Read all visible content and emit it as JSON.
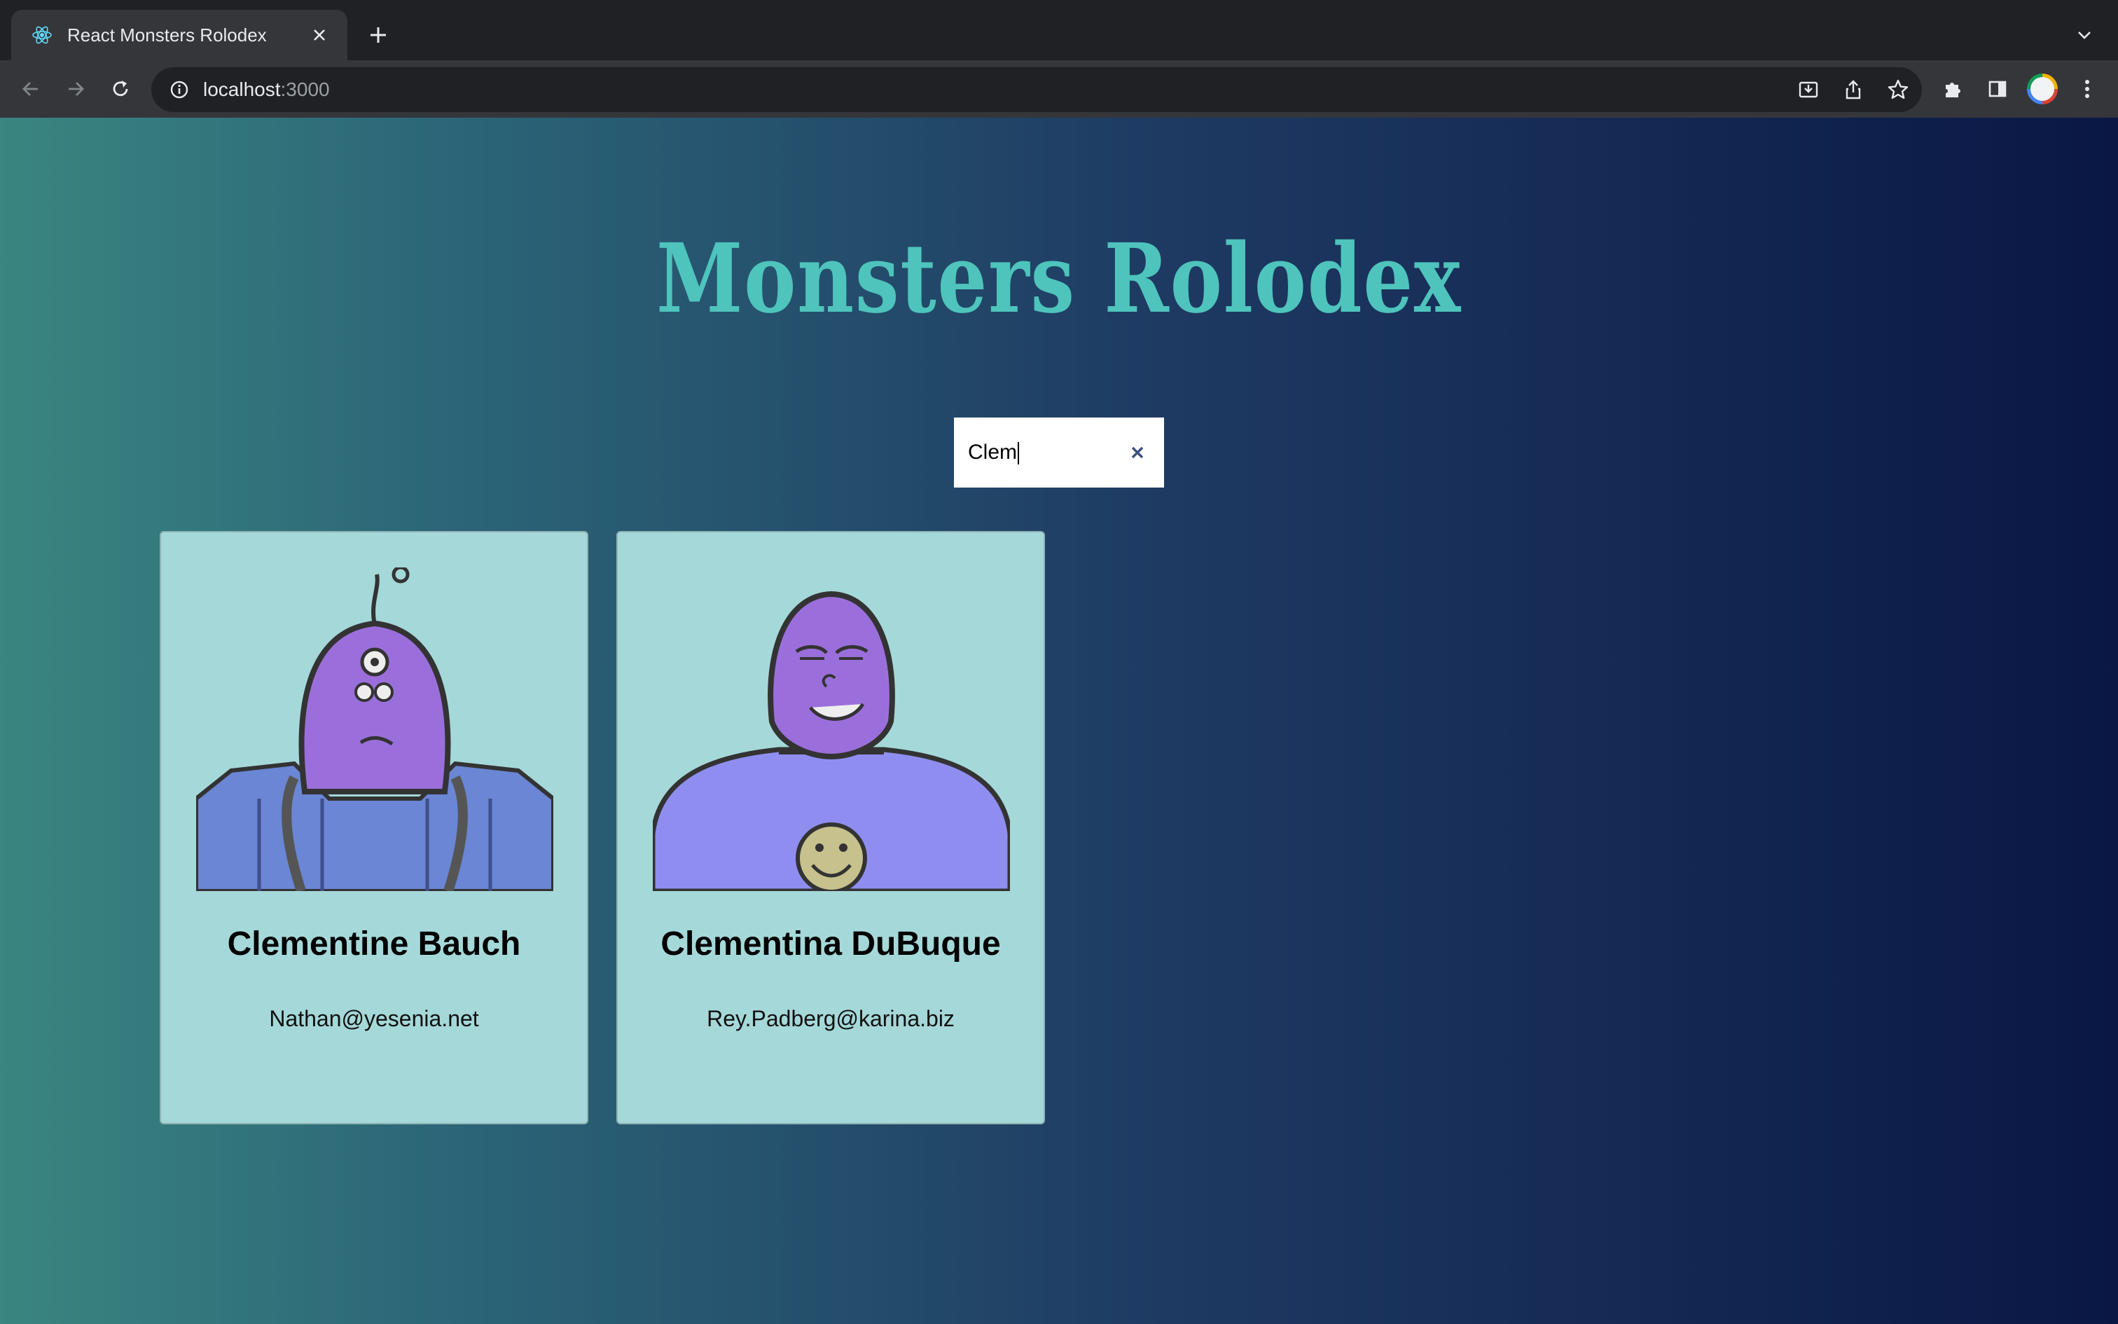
{
  "browser": {
    "tab_title": "React Monsters Rolodex",
    "url_host": "localhost",
    "url_port": ":3000"
  },
  "page": {
    "title": "Monsters Rolodex",
    "search": {
      "value": "Clem"
    }
  },
  "monsters": [
    {
      "name": "Clementine Bauch",
      "email": "Nathan@yesenia.net",
      "image": "robot-monster-tentacle"
    },
    {
      "name": "Clementina DuBuque",
      "email": "Rey.Padberg@karina.biz",
      "image": "robot-monster-smiley"
    }
  ],
  "colors": {
    "title": "#4ec4bc",
    "card_bg": "#a5d8d9",
    "monster_face": "#9b6fdb",
    "gradient_left": "#3a8580",
    "gradient_right": "#0a1745"
  }
}
